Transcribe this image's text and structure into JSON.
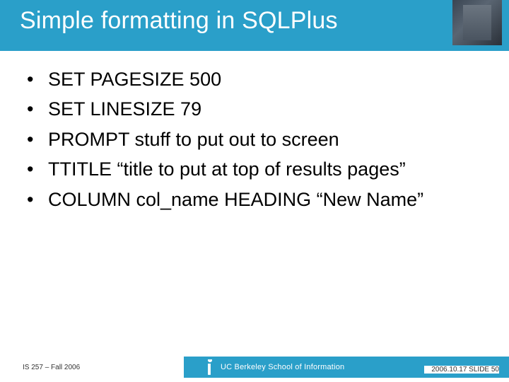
{
  "title": "Simple formatting in SQLPlus",
  "bullets": [
    "SET PAGESIZE 500",
    "SET LINESIZE 79",
    "PROMPT stuff to put out to screen",
    "TTITLE “title to put at top of results pages”",
    "COLUMN col_name HEADING “New Name”"
  ],
  "footer": {
    "left": "IS 257 – Fall 2006",
    "school": "UC Berkeley School of Information",
    "right": "2006.10.17 SLIDE 50"
  }
}
